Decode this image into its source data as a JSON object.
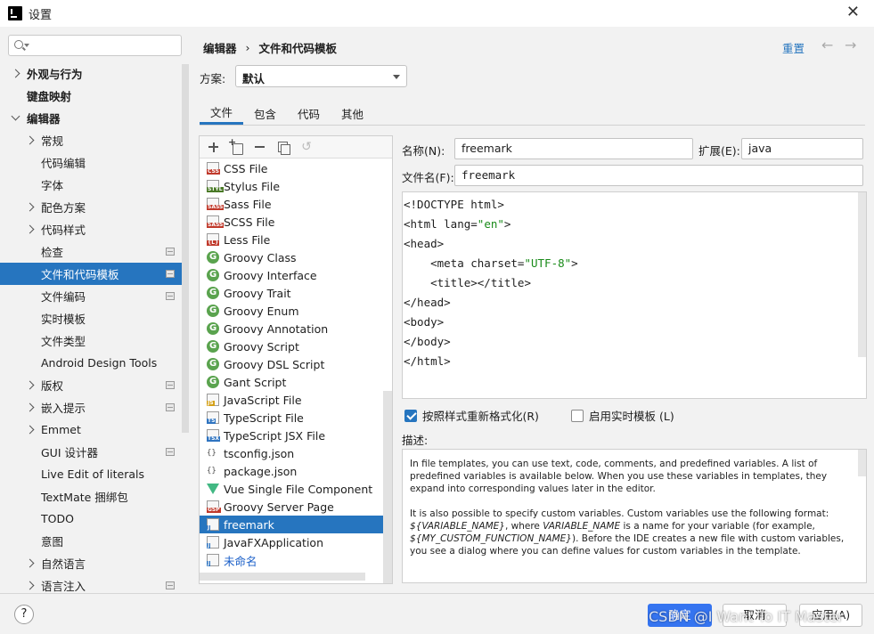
{
  "window": {
    "title": "设置"
  },
  "search": {
    "placeholder": ""
  },
  "sidebar": {
    "items": [
      {
        "label": "外观与行为",
        "chev": "right",
        "bold": true
      },
      {
        "label": "键盘映射",
        "bold": true
      },
      {
        "label": "编辑器",
        "chev": "down",
        "bold": true
      },
      {
        "label": "常规",
        "chev": "right"
      },
      {
        "label": "代码编辑"
      },
      {
        "label": "字体"
      },
      {
        "label": "配色方案",
        "chev": "right"
      },
      {
        "label": "代码样式",
        "chev": "right"
      },
      {
        "label": "检查",
        "icon": true
      },
      {
        "label": "文件和代码模板",
        "icon": true,
        "selected": true
      },
      {
        "label": "文件编码",
        "icon": true
      },
      {
        "label": "实时模板"
      },
      {
        "label": "文件类型"
      },
      {
        "label": "Android Design Tools"
      },
      {
        "label": "版权",
        "chev": "right",
        "icon": true
      },
      {
        "label": "嵌入提示",
        "chev": "right",
        "icon": true
      },
      {
        "label": "Emmet",
        "chev": "right"
      },
      {
        "label": "GUI 设计器",
        "icon": true
      },
      {
        "label": "Live Edit of literals"
      },
      {
        "label": "TextMate 捆绑包"
      },
      {
        "label": "TODO"
      },
      {
        "label": "意图"
      },
      {
        "label": "自然语言",
        "chev": "right"
      },
      {
        "label": "语言注入",
        "chev": "right",
        "icon": true
      }
    ]
  },
  "breadcrumb": {
    "parent": "编辑器",
    "separator": "›",
    "current": "文件和代码模板"
  },
  "header": {
    "reset": "重置",
    "back": "←",
    "forward": "→"
  },
  "scheme": {
    "label": "方案:",
    "value": "默认"
  },
  "tabs": [
    {
      "label": "文件",
      "active": true
    },
    {
      "label": "包含"
    },
    {
      "label": "代码"
    },
    {
      "label": "其他"
    }
  ],
  "templates": [
    {
      "name": "CSS File",
      "icon": "file",
      "tag": "CSS",
      "tagColor": "#c0392b"
    },
    {
      "name": "Stylus File",
      "icon": "file",
      "tag": "STYL",
      "tagColor": "#4a7a27"
    },
    {
      "name": "Sass File",
      "icon": "file",
      "tag": "SASS",
      "tagColor": "#c0392b"
    },
    {
      "name": "SCSS File",
      "icon": "file",
      "tag": "SASS",
      "tagColor": "#c0392b"
    },
    {
      "name": "Less File",
      "icon": "file",
      "tag": "{L}",
      "tagColor": "#c0392b"
    },
    {
      "name": "Groovy Class",
      "icon": "groovy"
    },
    {
      "name": "Groovy Interface",
      "icon": "groovy"
    },
    {
      "name": "Groovy Trait",
      "icon": "groovy"
    },
    {
      "name": "Groovy Enum",
      "icon": "groovy"
    },
    {
      "name": "Groovy Annotation",
      "icon": "groovy"
    },
    {
      "name": "Groovy Script",
      "icon": "groovy"
    },
    {
      "name": "Groovy DSL Script",
      "icon": "groovy"
    },
    {
      "name": "Gant Script",
      "icon": "groovy"
    },
    {
      "name": "JavaScript File",
      "icon": "file",
      "tag": "JS",
      "tagColor": "#d4a017"
    },
    {
      "name": "TypeScript File",
      "icon": "file",
      "tag": "TS",
      "tagColor": "#2f74c0"
    },
    {
      "name": "TypeScript JSX File",
      "icon": "file",
      "tag": "TSX",
      "tagColor": "#2f74c0"
    },
    {
      "name": "tsconfig.json",
      "icon": "json"
    },
    {
      "name": "package.json",
      "icon": "json"
    },
    {
      "name": "Vue Single File Component",
      "icon": "vue"
    },
    {
      "name": "Groovy Server Page",
      "icon": "file",
      "tag": "GSP",
      "tagColor": "#c0392b"
    },
    {
      "name": "freemark",
      "icon": "file",
      "tag": "J",
      "tagColor": "#2f74c0",
      "selected": true
    },
    {
      "name": "JavaFXApplication",
      "icon": "file",
      "tag": "J",
      "tagColor": "#2f74c0"
    },
    {
      "name": "未命名",
      "icon": "file",
      "tag": "J",
      "tagColor": "#2f74c0",
      "blue": true
    }
  ],
  "form": {
    "name_label": "名称(N):",
    "name_value": "freemark",
    "ext_label": "扩展(E):",
    "ext_value": "java",
    "filename_label": "文件名(F):",
    "filename_value": "freemark"
  },
  "editor": {
    "lines": [
      [
        {
          "t": "<!DOCTYPE html>"
        }
      ],
      [
        {
          "t": "<html lang="
        },
        {
          "t": "\"en\"",
          "c": "str"
        },
        {
          "t": ">"
        }
      ],
      [
        {
          "t": "<head>"
        }
      ],
      [
        {
          "t": "    <meta charset="
        },
        {
          "t": "\"UTF-8\"",
          "c": "str"
        },
        {
          "t": ">"
        }
      ],
      [
        {
          "t": "    <title></title>"
        }
      ],
      [
        {
          "t": "</head>"
        }
      ],
      [
        {
          "t": "<body>"
        }
      ],
      [
        {
          "t": "</body>"
        }
      ],
      [
        {
          "t": "</html>"
        }
      ]
    ]
  },
  "options": {
    "reformat_label": "按照样式重新格式化(R)",
    "reformat_checked": true,
    "live_label": "启用实时模板 (L)",
    "live_checked": false
  },
  "description": {
    "label": "描述:",
    "para1": "In file templates, you can use text, code, comments, and predefined variables. A list of predefined variables is available below. When you use these variables in templates, they expand into corresponding values later in the editor.",
    "para2_a": "It is also possible to specify custom variables. Custom variables use the following format: ",
    "para2_var": "${VARIABLE_NAME}",
    "para2_b": ", where ",
    "para2_var2": "VARIABLE_NAME",
    "para2_c": " is a name for your variable (for example, ",
    "para2_var3": "${MY_CUSTOM_FUNCTION_NAME}",
    "para2_d": "). Before the IDE creates a new file with custom variables, you see a dialog where you can define values for custom variables in the template."
  },
  "footer": {
    "help": "?",
    "ok": "确定",
    "cancel": "取消",
    "apply": "应用(A)"
  },
  "watermark": "CSDN @I Want To IT Master",
  "colors": {
    "accent": "#2675bf",
    "primary_button": "#3574f0",
    "string": "#188a18"
  }
}
